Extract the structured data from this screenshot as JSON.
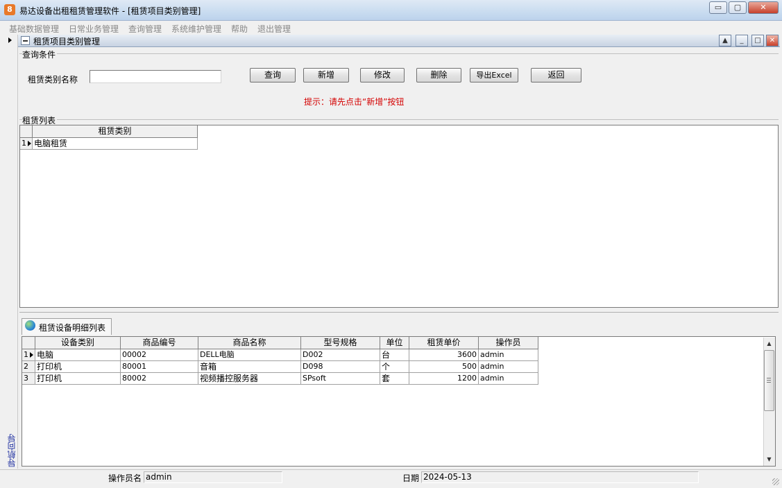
{
  "window": {
    "icon_text": "8",
    "title": "易达设备出租租赁管理软件  - [租赁项目类别管理]",
    "min_label": "▭",
    "max_label": "▢",
    "close_label": "✕"
  },
  "menu": [
    {
      "label": "基础数据管理"
    },
    {
      "label": "日常业务管理"
    },
    {
      "label": "查询管理"
    },
    {
      "label": "系统维护管理"
    },
    {
      "label": "帮助"
    },
    {
      "label": "退出管理"
    }
  ],
  "nav": {
    "label": "导航向导"
  },
  "inner_window": {
    "title": "租赁项目类别管理",
    "btn_up": "▲",
    "btn_min": "_",
    "btn_max": "□",
    "btn_close": "✕"
  },
  "query": {
    "group_label": "查询条件",
    "field_label": "租赁类别名称",
    "field_value": "",
    "buttons": {
      "search": "查询",
      "add": "新增",
      "edit": "修改",
      "delete": "删除",
      "export": "导出Excel",
      "back": "返回"
    },
    "hint": "提示：请先点击“新增”按钮"
  },
  "category_list": {
    "group_label": "租赁列表",
    "header": "租赁类别",
    "rows": [
      {
        "num": "1",
        "name": "电脑租赁"
      }
    ]
  },
  "detail": {
    "tab_label": "租赁设备明细列表",
    "headers": [
      "设备类别",
      "商品编号",
      "商品名称",
      "型号规格",
      "单位",
      "租赁单价",
      "操作员"
    ],
    "rows": [
      {
        "num": "1",
        "cells": [
          "电脑",
          "00002",
          "DELL电脑",
          "D002",
          "台",
          "3600",
          "admin"
        ]
      },
      {
        "num": "2",
        "cells": [
          "打印机",
          "80001",
          "音箱",
          "D098",
          "个",
          "500",
          "admin"
        ]
      },
      {
        "num": "3",
        "cells": [
          "打印机",
          "80002",
          "视频播控服务器",
          "SPsoft",
          "套",
          "1200",
          "admin"
        ]
      }
    ]
  },
  "statusbar": {
    "operator_label": "操作员名",
    "operator_value": "admin",
    "date_label": "日期",
    "date_value": "2024-05-13"
  }
}
